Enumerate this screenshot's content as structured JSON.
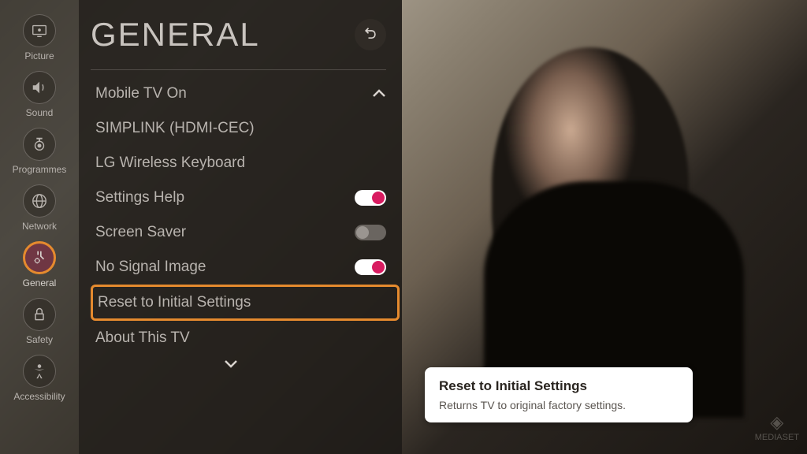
{
  "sidebar": {
    "items": [
      {
        "label": "Picture",
        "icon": "picture"
      },
      {
        "label": "Sound",
        "icon": "sound"
      },
      {
        "label": "Programmes",
        "icon": "programmes"
      },
      {
        "label": "Network",
        "icon": "network"
      },
      {
        "label": "General",
        "icon": "general",
        "selected": true
      },
      {
        "label": "Safety",
        "icon": "safety"
      },
      {
        "label": "Accessibility",
        "icon": "accessibility"
      }
    ]
  },
  "panel": {
    "title": "GENERAL",
    "items": [
      {
        "label": "Mobile TV On",
        "type": "link"
      },
      {
        "label": "SIMPLINK (HDMI-CEC)",
        "type": "link"
      },
      {
        "label": "LG Wireless Keyboard",
        "type": "link"
      },
      {
        "label": "Settings Help",
        "type": "toggle",
        "on": true
      },
      {
        "label": "Screen Saver",
        "type": "toggle",
        "on": false
      },
      {
        "label": "No Signal Image",
        "type": "toggle",
        "on": true
      },
      {
        "label": "Reset to Initial Settings",
        "type": "link",
        "highlighted": true
      },
      {
        "label": "About This TV",
        "type": "link"
      }
    ]
  },
  "tooltip": {
    "title": "Reset to Initial Settings",
    "description": "Returns TV to original factory settings."
  },
  "watermark": "MEDIASET"
}
